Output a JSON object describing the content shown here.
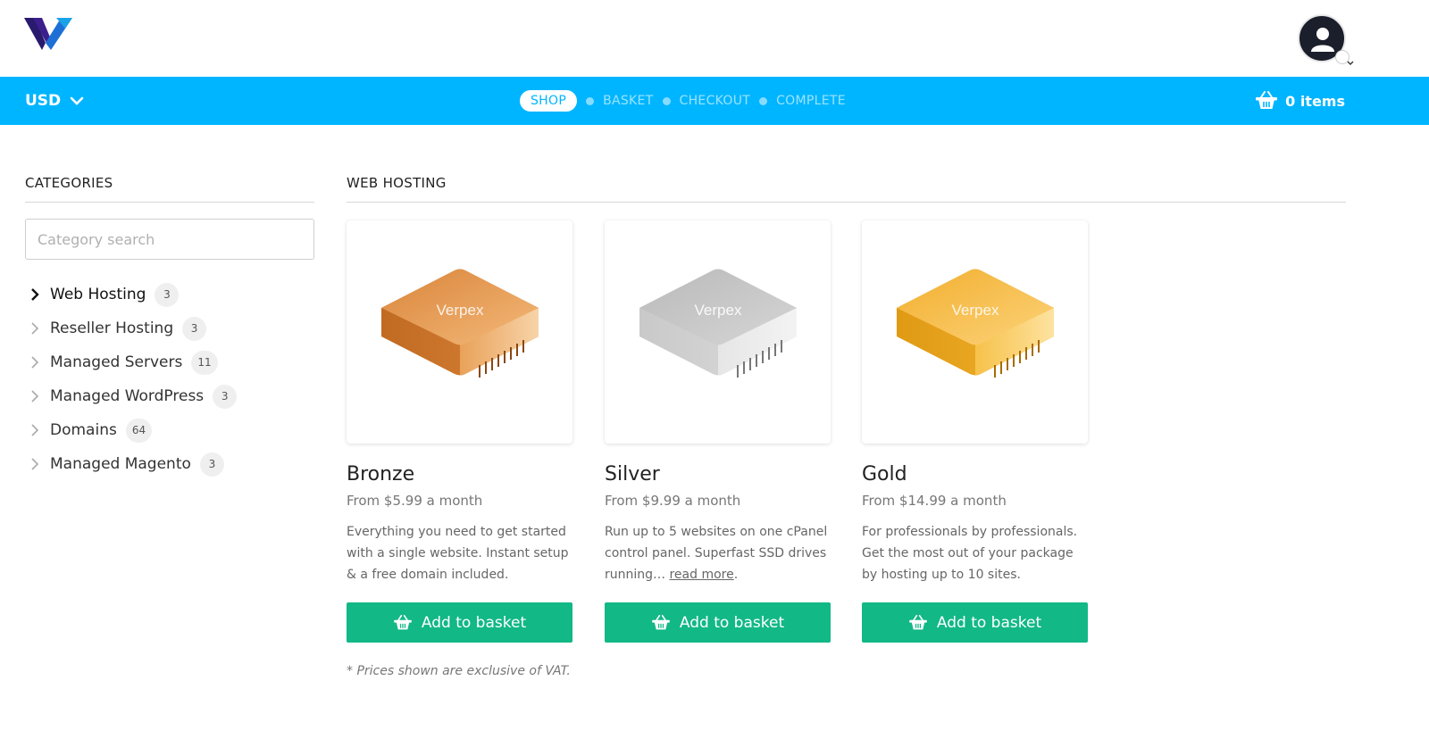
{
  "header": {
    "logo_icon": "verpex-logo-icon",
    "user_icon": "user-avatar-icon"
  },
  "navbar": {
    "currency": "USD",
    "steps": [
      {
        "label": "SHOP",
        "active": true
      },
      {
        "label": "BASKET",
        "active": false
      },
      {
        "label": "CHECKOUT",
        "active": false
      },
      {
        "label": "COMPLETE",
        "active": false
      }
    ],
    "basket_label": "0 items"
  },
  "sidebar": {
    "title": "CATEGORIES",
    "search_placeholder": "Category search",
    "items": [
      {
        "label": "Web Hosting",
        "count": "3",
        "active": true
      },
      {
        "label": "Reseller Hosting",
        "count": "3",
        "active": false
      },
      {
        "label": "Managed Servers",
        "count": "11",
        "active": false
      },
      {
        "label": "Managed WordPress",
        "count": "3",
        "active": false
      },
      {
        "label": "Domains",
        "count": "64",
        "active": false
      },
      {
        "label": "Managed Magento",
        "count": "3",
        "active": false
      }
    ]
  },
  "main": {
    "title": "WEB HOSTING",
    "products": [
      {
        "name": "Bronze",
        "price": "From $5.99 a month",
        "description": "Everything you need to get started with a single website. Instant setup & a free domain included.",
        "brand_text": "Verpex",
        "color": "#e08a3a",
        "button": "Add to basket"
      },
      {
        "name": "Silver",
        "price": "From $9.99 a month",
        "description": "Run up to 5 websites on one cPanel control panel. Superfast SSD drives running…",
        "read_more": "read more",
        "brand_text": "Verpex",
        "color": "#bdbdbd",
        "button": "Add to basket"
      },
      {
        "name": "Gold",
        "price": "From $14.99 a month",
        "description": "For professionals by professionals. Get the most out of your package by hosting up to 10 sites.",
        "brand_text": "Verpex",
        "color": "#f2b233",
        "button": "Add to basket"
      }
    ],
    "vat_note": "* Prices shown are exclusive of VAT."
  },
  "colors": {
    "accent": "#00b5ff",
    "button": "#12b886"
  }
}
